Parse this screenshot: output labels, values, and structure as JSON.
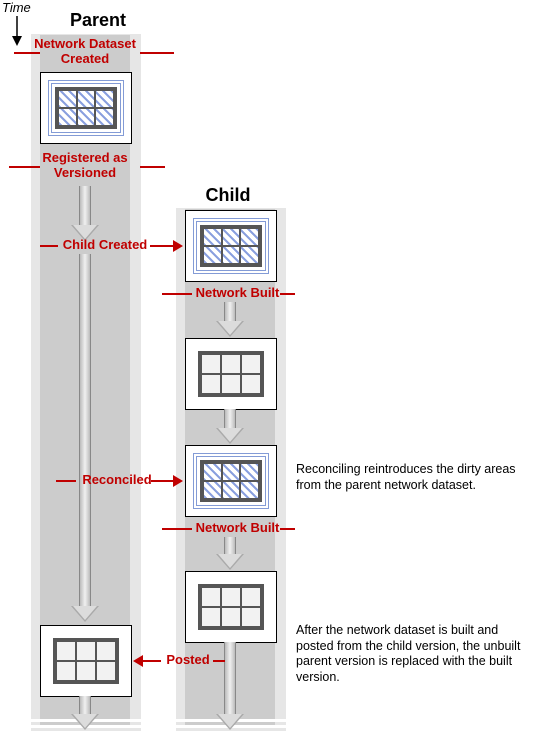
{
  "time_label": "Time",
  "columns": {
    "parent": "Parent",
    "child": "Child"
  },
  "events": {
    "created": "Network Dataset\nCreated",
    "registered": "Registered as\nVersioned",
    "child_created": "Child Created",
    "network_built_1": "Network Built",
    "reconciled": "Reconciled",
    "network_built_2": "Network Built",
    "posted": "Posted"
  },
  "annotations": {
    "reconcile_note": "Reconciling reintroduces the dirty areas from the parent network dataset.",
    "post_note": "After the network dataset is built and posted from the child version, the unbuilt parent version is replaced with the built version."
  }
}
